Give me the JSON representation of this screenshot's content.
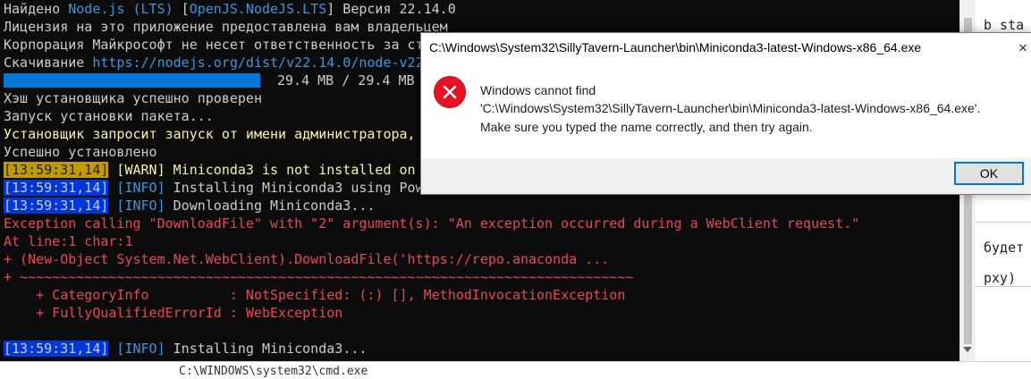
{
  "background_window": {
    "fragments": [
      "b sta",
      "будет",
      "pxy)"
    ]
  },
  "bottom_strip": {
    "text": "C:\\WINDOWS\\system32\\cmd.exe"
  },
  "terminal": {
    "lines": {
      "l0_a": "Найдено ",
      "l0_b": "Node.js (LTS)",
      "l0_c": " [",
      "l0_d": "OpenJS.NodeJS.LTS",
      "l0_e": "] Версия 22.14.0",
      "l1": "Лицензия на это приложение предоставлена вам владельцем",
      "l2": "Корпорация Майкрософт не несет ответственность за ст",
      "l3_a": "Скачивание ",
      "l3_b": "https://nodejs.org/dist/v22.14.0/node-v22",
      "progress_text": "29.4 MB / 29.4 MB",
      "l5": "Хэш установщика успешно проверен",
      "l6": "Запуск установки пакета...",
      "l7": "Установщик запросит запуск от имени администратора,",
      "l8": "Успешно установлено",
      "log1_time": "[13:59:31,14]",
      "log1_level": " [WARN] ",
      "log1_msg": "Miniconda3 is not installed on",
      "log2_time": "[13:59:31,14]",
      "log2_level": " [INFO] ",
      "log2_msg": "Installing Miniconda3 using Pow",
      "log3_time": "[13:59:31,14]",
      "log3_level": " [INFO] ",
      "log3_msg": "Downloading Miniconda3...",
      "err1": "Exception calling \"DownloadFile\" with \"2\" argument(s): \"An exception occurred during a WebClient request.\"",
      "err2": "At line:1 char:1",
      "err3": "+ (New-Object System.Net.WebClient).DownloadFile('https://repo.anaconda ...",
      "err4": "+ ~~~~~~~~~~~~~~~~~~~~~~~~~~~~~~~~~~~~~~~~~~~~~~~~~~~~~~~~~~~~~~~~~~~~~~~~~~~~",
      "err5": "    + CategoryInfo          : NotSpecified: (:) [], MethodInvocationException",
      "err6": "    + FullyQualifiedErrorId : WebException",
      "log4_time": "[13:59:31,14]",
      "log4_level": " [INFO] ",
      "log4_msg": "Installing Miniconda3..."
    },
    "progress": 1.0
  },
  "dialog": {
    "title": "C:\\Windows\\System32\\SillyTavern-Launcher\\bin\\Miniconda3-latest-Windows-x86_64.exe",
    "close_icon": "×",
    "message_line1": "Windows cannot find",
    "message_line2": "'C:\\Windows\\System32\\SillyTavern-Launcher\\bin\\Miniconda3-latest-Windows-x86_64.exe'.",
    "message_line3": "Make sure you typed the name correctly, and then try again.",
    "ok_label": "OK",
    "icon": "error-icon"
  },
  "colors": {
    "terminal_bg": "#0c0c0c",
    "terminal_text": "#cccccc",
    "cyan": "#3a96dd",
    "yellow": "#f9f1a5",
    "red": "#e74856",
    "warn_bg": "#c19c00",
    "info_bg": "#0037da",
    "progress": "#0078d7",
    "error_icon": "#e81123"
  }
}
